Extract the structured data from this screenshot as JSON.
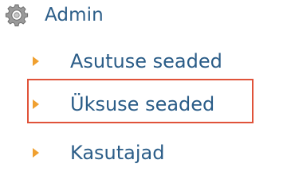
{
  "menu": {
    "header": {
      "label": "Admin",
      "icon": "gear-icon"
    },
    "items": [
      {
        "label": "Asutuse seaded",
        "icon": "caret-right-icon"
      },
      {
        "label": "Üksuse seaded",
        "icon": "caret-right-icon",
        "highlighted": true
      },
      {
        "label": "Kasutajad",
        "icon": "caret-right-icon"
      }
    ]
  },
  "colors": {
    "link_text": "#2b5d88",
    "arrow": "#f0a030",
    "highlight_border": "#e0533a",
    "gear": "#8a8a8a"
  }
}
